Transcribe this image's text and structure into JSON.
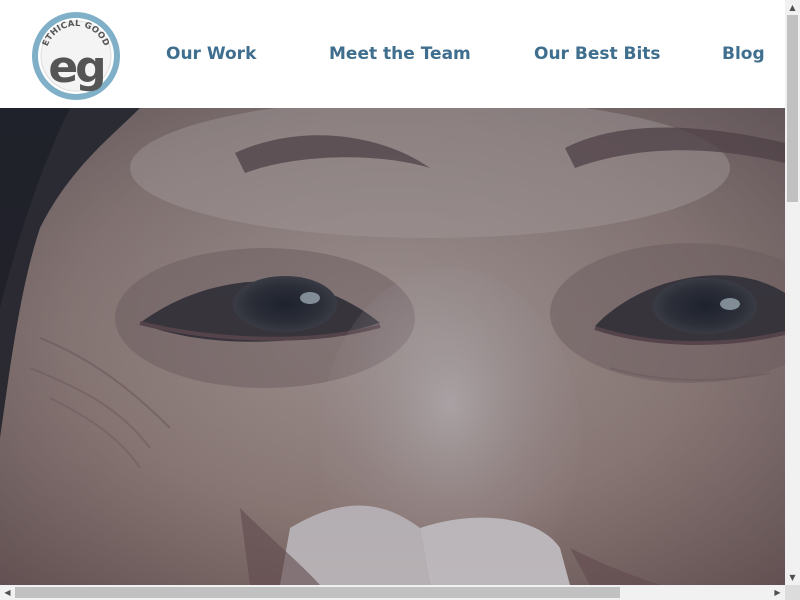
{
  "logo": {
    "line1": "ETHICAL GOOD",
    "line2": "eg"
  },
  "nav": {
    "items": [
      {
        "label": "Our Work"
      },
      {
        "label": "Meet the Team"
      },
      {
        "label": "Our Best Bits"
      },
      {
        "label": "Blog"
      }
    ]
  },
  "colors": {
    "nav_text": "#3f6e8e",
    "logo_ring": "#7fb0c8",
    "logo_fill": "#555555",
    "hero_tint": "#243c52"
  },
  "icons": {
    "scroll_up": "triangle-up-icon",
    "scroll_down": "triangle-down-icon",
    "scroll_left": "triangle-left-icon",
    "scroll_right": "triangle-right-icon"
  }
}
